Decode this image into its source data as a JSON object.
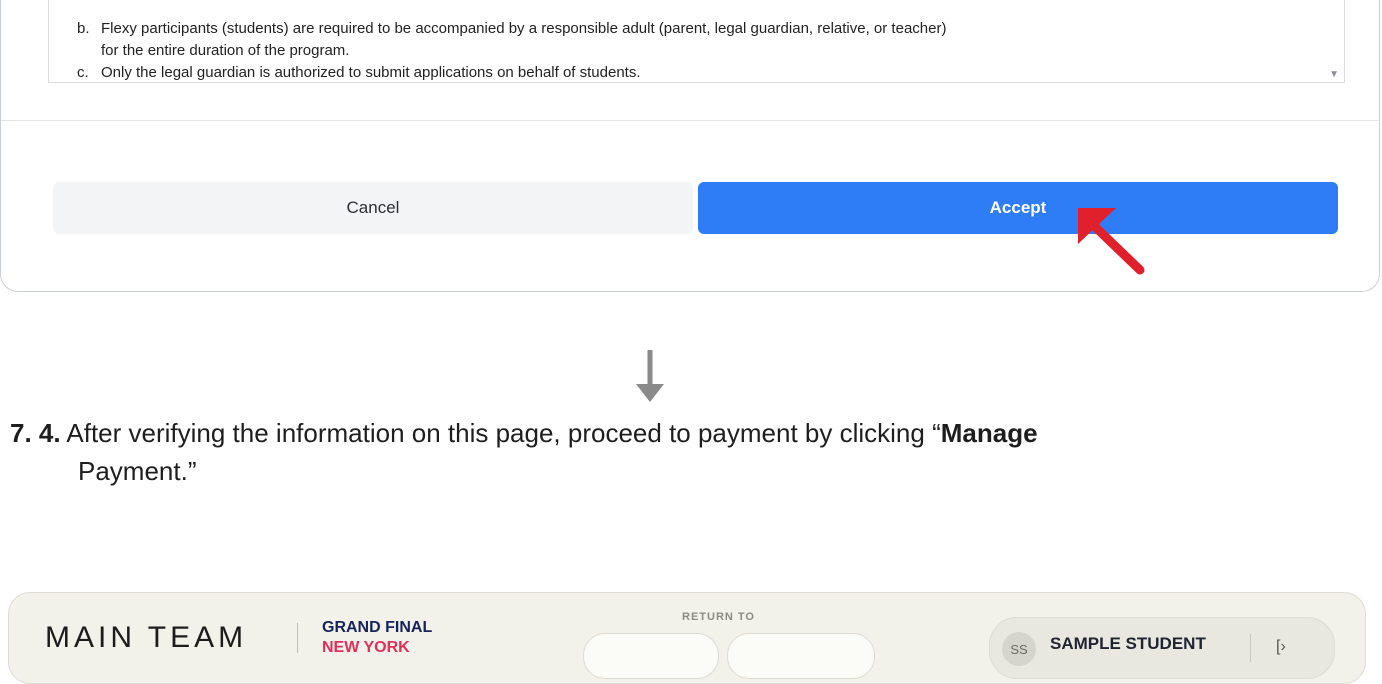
{
  "terms": {
    "items": [
      {
        "letter": "b.",
        "line1": "Flexy participants (students) are required to be accompanied by a responsible adult (parent, legal guardian, relative, or teacher)",
        "line2": "for the entire duration of the program."
      },
      {
        "letter": "c.",
        "line1": "Only the legal guardian is authorized to submit applications on behalf of students."
      }
    ]
  },
  "dialog": {
    "cancel_label": "Cancel",
    "accept_label": "Accept",
    "accept_color": "#2e7cf6",
    "pointer_color": "#e0202a"
  },
  "step": {
    "number": "7. 4.",
    "text_before": "After verifying the information on this page, proceed to payment by clicking “",
    "bold_text": "Manage",
    "bold_text_line2": "Payment.",
    "text_after": "”"
  },
  "header": {
    "team_name": "MAIN TEAM",
    "event_line1": "GRAND FINAL",
    "event_line2": "NEW YORK",
    "return_to_label": "RETURN TO",
    "user_initials": "SS",
    "user_name": "SAMPLE STUDENT",
    "logout_icon": "logout-icon"
  }
}
